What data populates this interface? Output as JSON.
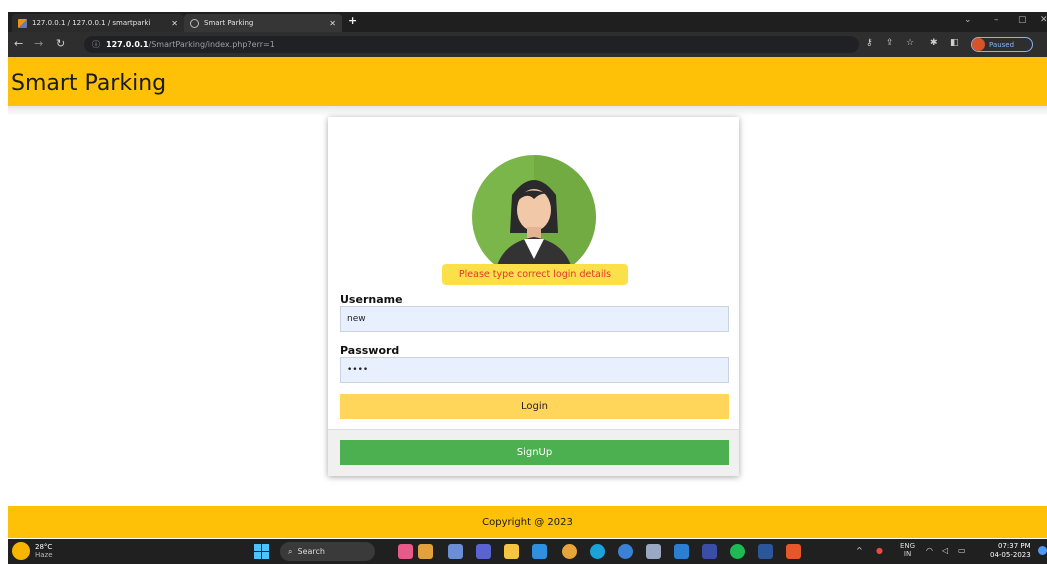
{
  "browser": {
    "tabs": [
      {
        "label": "127.0.0.1 / 127.0.0.1 / smartparki",
        "active": false
      },
      {
        "label": "Smart Parking",
        "active": true
      }
    ],
    "new_tab": "+",
    "url_host": "127.0.0.1",
    "url_path": "/SmartParking/index.php?err=1",
    "profile_label": "Paused"
  },
  "header": {
    "brand": "Smart Parking"
  },
  "login": {
    "error": "Please type correct login details",
    "username_label": "Username",
    "username_value": "new",
    "password_label": "Password",
    "password_value": "••••",
    "login_button": "Login",
    "signup_button": "SignUp"
  },
  "footer": {
    "copyright": "Copyright @ 2023"
  },
  "taskbar": {
    "weather_temp": "28°C",
    "weather_desc": "Haze",
    "search": "Search",
    "lang_top": "ENG",
    "lang_bottom": "IN",
    "time": "07:37 PM",
    "date": "04-05-2023"
  },
  "colors": {
    "header": "#fec107",
    "login_button": "#ffd65a",
    "signup_button": "#4caf50",
    "error_bg": "#fbe04a",
    "error_text": "#e3372a"
  }
}
